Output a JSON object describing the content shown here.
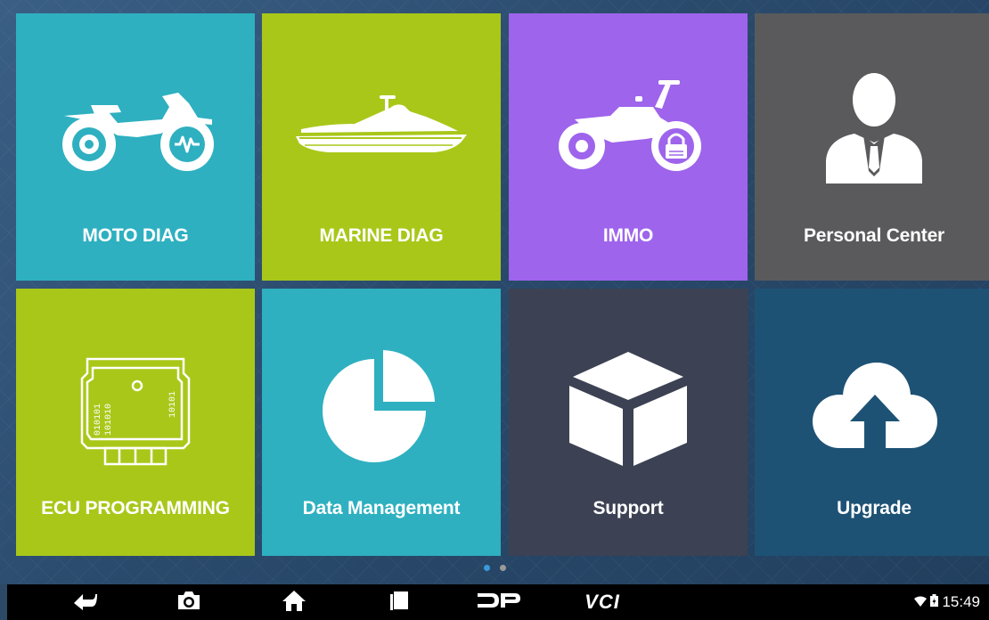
{
  "tiles": [
    {
      "label": "MOTO DIAG",
      "icon": "dirt-bike-diagnostic-icon",
      "color": "#2eb0c0"
    },
    {
      "label": "MARINE DIAG",
      "icon": "jet-ski-icon",
      "color": "#a9c719"
    },
    {
      "label": "IMMO",
      "icon": "motorcycle-lock-icon",
      "color": "#9e64ec"
    },
    {
      "label": "Personal Center",
      "icon": "person-icon",
      "color": "#5a5a5c"
    },
    {
      "label": "ECU PROGRAMMING",
      "icon": "ecu-chip-icon",
      "color": "#a9c719"
    },
    {
      "label": "Data Management",
      "icon": "pie-chart-icon",
      "color": "#2eb0c0"
    },
    {
      "label": "Support",
      "icon": "box-icon",
      "color": "#3c4253"
    },
    {
      "label": "Upgrade",
      "icon": "cloud-upload-icon",
      "color": "#1d5275"
    }
  ],
  "pager": {
    "current_page": 1,
    "total_pages": 2,
    "active_color": "#3a9ad9",
    "inactive_color": "#9a9a9a"
  },
  "navbar": {
    "vci_label": "VCI",
    "dp_label": "DP",
    "time": "15:49",
    "battery_icon": "battery-icon",
    "wifi_icon": "wifi-icon"
  }
}
